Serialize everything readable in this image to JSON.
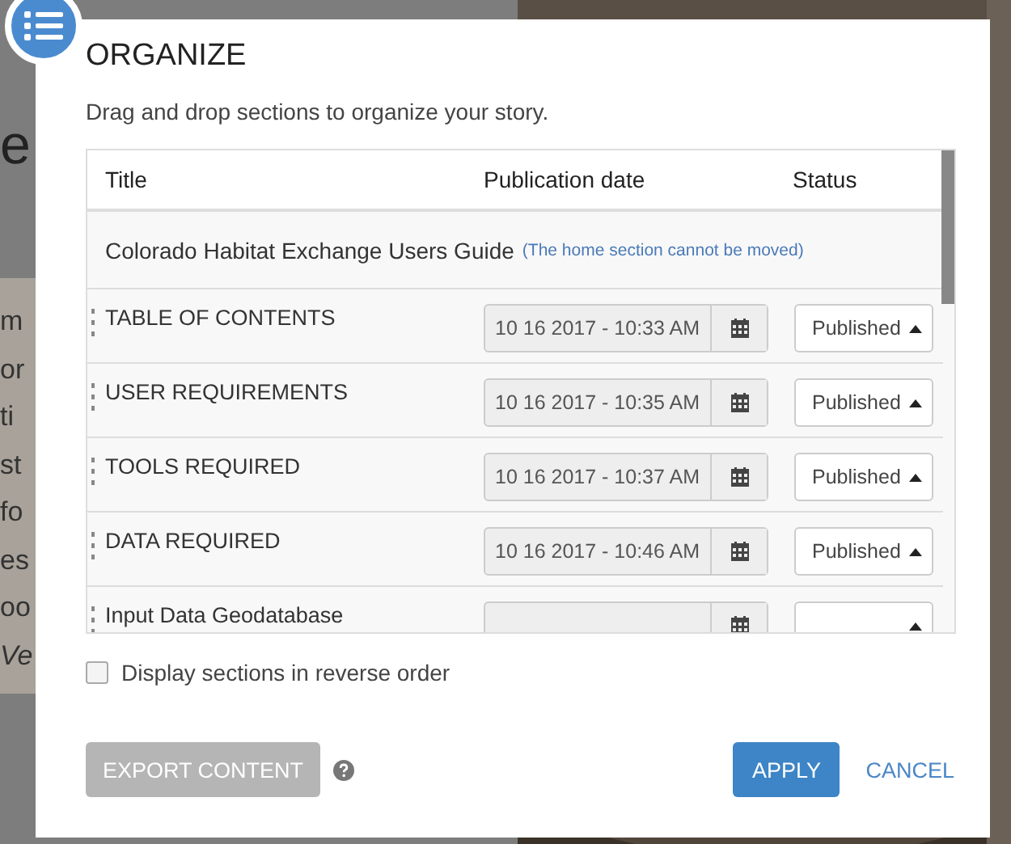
{
  "background": {
    "heading_fragment": "e",
    "fragments": [
      "m",
      "or",
      "ti",
      "st",
      "fo",
      "es",
      "oo",
      "Ve"
    ]
  },
  "dialog": {
    "title": "ORGANIZE",
    "subtitle": "Drag and drop sections to organize your story.",
    "table": {
      "columns": [
        "Title",
        "Publication date",
        "Status"
      ],
      "home_row": {
        "title": "Colorado Habitat Exchange Users Guide",
        "note": "(The home section cannot be moved)"
      },
      "rows": [
        {
          "title": "TABLE OF CONTENTS",
          "date": "10 16 2017 - 10:33 AM",
          "status": "Published"
        },
        {
          "title": "USER REQUIREMENTS",
          "date": "10 16 2017 - 10:35 AM",
          "status": "Published"
        },
        {
          "title": "TOOLS REQUIRED",
          "date": "10 16 2017 - 10:37 AM",
          "status": "Published"
        },
        {
          "title": "DATA REQUIRED",
          "date": "10 16 2017 - 10:46 AM",
          "status": "Published"
        },
        {
          "title": "Input Data Geodatabase"
        }
      ]
    },
    "reverse_order": {
      "label": "Display sections in reverse order",
      "checked": false
    },
    "export": {
      "label": "EXPORT CONTENT",
      "disabled": true
    },
    "apply": "APPLY",
    "cancel": "CANCEL"
  }
}
